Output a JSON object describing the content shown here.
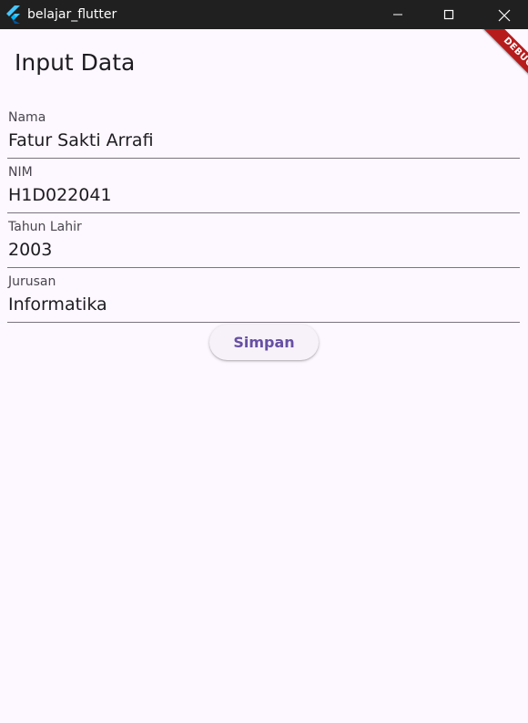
{
  "window": {
    "title": "belajar_flutter",
    "icon": "flutter-logo-icon"
  },
  "debug_banner": {
    "label": "DEBUG",
    "color": "#b71c1c"
  },
  "appbar": {
    "title": "Input Data"
  },
  "form": {
    "fields": [
      {
        "label": "Nama",
        "value": "Fatur Sakti Arrafi"
      },
      {
        "label": "NIM",
        "value": "H1D022041"
      },
      {
        "label": "Tahun Lahir",
        "value": "2003"
      },
      {
        "label": "Jurusan",
        "value": "Informatika"
      }
    ],
    "save_label": "Simpan"
  },
  "colors": {
    "background": "#fdf7ff",
    "primary": "#6750a4",
    "titlebar": "#202020"
  }
}
